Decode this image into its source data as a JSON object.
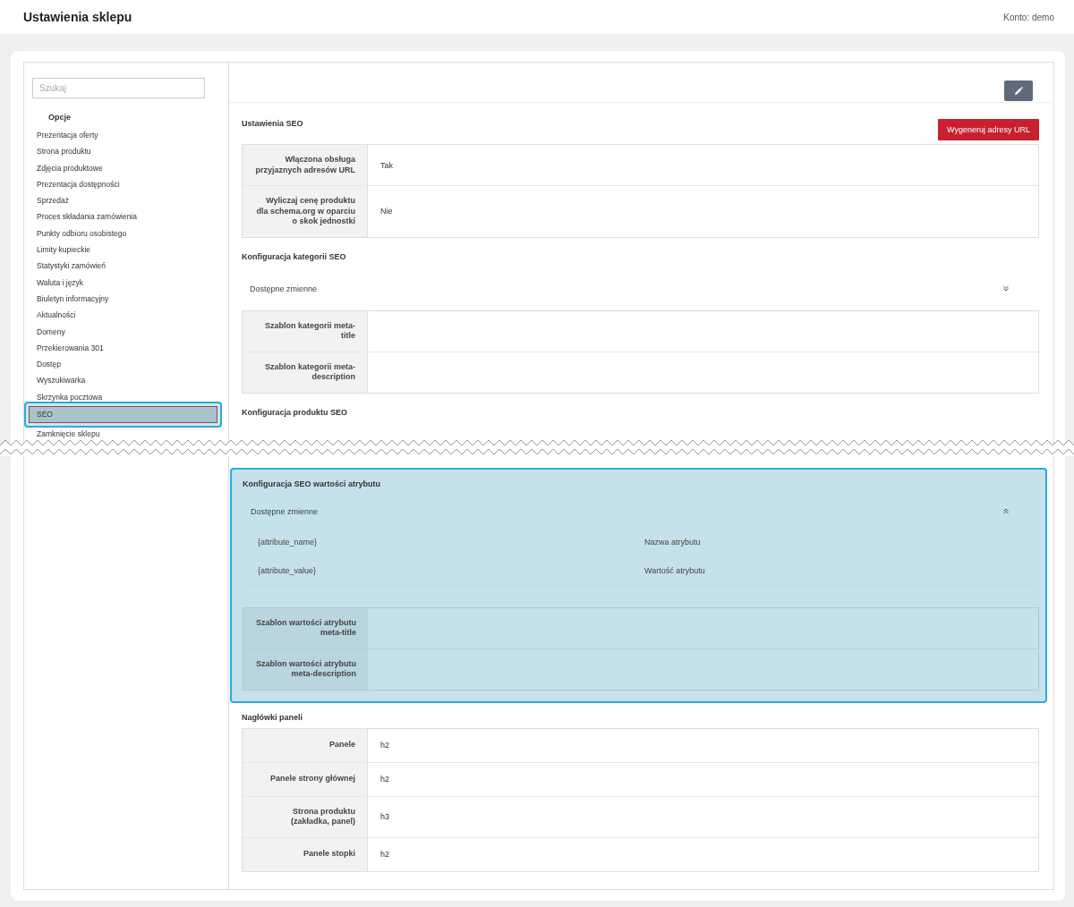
{
  "header": {
    "title": "Ustawienia sklepu",
    "account": "Konto: demo"
  },
  "sidebar": {
    "search": {
      "placeholder": "Szukaj"
    },
    "heading": "Opcje",
    "items": [
      {
        "label": "Prezentacja oferty",
        "selected": false
      },
      {
        "label": "Strona produktu",
        "selected": false
      },
      {
        "label": "Zdjęcia produktowe",
        "selected": false
      },
      {
        "label": "Prezentacja dostępności",
        "selected": false
      },
      {
        "label": "Sprzedaż",
        "selected": false
      },
      {
        "label": "Proces składania zamówienia",
        "selected": false
      },
      {
        "label": "Punkty odbioru osobistego",
        "selected": false
      },
      {
        "label": "Limity kupieckie",
        "selected": false
      },
      {
        "label": "Statystyki zamówień",
        "selected": false
      },
      {
        "label": "Waluta i język",
        "selected": false
      },
      {
        "label": "Biuletyn informacyjny",
        "selected": false
      },
      {
        "label": "Aktualności",
        "selected": false
      },
      {
        "label": "Domeny",
        "selected": false
      },
      {
        "label": "Przekierowania 301",
        "selected": false
      },
      {
        "label": "Dostęp",
        "selected": false
      },
      {
        "label": "Wyszukiwarka",
        "selected": false
      },
      {
        "label": "Skrzynka pocztowa",
        "selected": false
      },
      {
        "label": "SEO",
        "selected": true
      },
      {
        "label": "Zamknięcie sklepu",
        "selected": false
      }
    ]
  },
  "main": {
    "sections": [
      {
        "kind": "table",
        "title": "Ustawienia SEO",
        "highlighted": false,
        "action": "Wygeneruj adresy URL",
        "rows": [
          {
            "label": "Włączona obsługa przyjaznych adresów URL",
            "value": "Tak"
          },
          {
            "label": "Wyliczaj cenę produktu dla schema.org w oparciu o skok jednostki",
            "value": "Nie"
          }
        ]
      },
      {
        "kind": "config",
        "title": "Konfiguracja kategorii SEO",
        "highlighted": false,
        "variables": {
          "label": "Dostępne zmienne",
          "expanded": false
        },
        "rows": [
          {
            "label": "Szablon kategorii meta-title"
          },
          {
            "label": "Szablon kategorii meta-description"
          }
        ]
      },
      {
        "kind": "torn",
        "title": "Konfiguracja produktu SEO",
        "highlighted": false
      },
      {
        "kind": "config",
        "title": "Konfiguracja SEO wartości atrybutu",
        "highlighted": true,
        "variables": {
          "label": "Dostępne zmienne",
          "expanded": true,
          "items": [
            {
              "name": "{attribute_name}",
              "description": "Nazwa atrybutu"
            },
            {
              "name": "{attribute_value}",
              "description": "Wartość atrybutu"
            }
          ]
        },
        "rows": [
          {
            "label": "Szablon wartości atrybutu meta-title"
          },
          {
            "label": "Szablon wartości atrybutu meta-description"
          }
        ]
      },
      {
        "kind": "table",
        "title": "Nagłówki paneli",
        "highlighted": false,
        "rows": [
          {
            "label": "Panele",
            "value": "h2"
          },
          {
            "label": "Panele strony głównej",
            "value": "h2"
          },
          {
            "label": "Strona produktu (zakładka, panel)",
            "value": "h3"
          },
          {
            "label": "Panele stopki",
            "value": "h2"
          }
        ]
      }
    ]
  }
}
